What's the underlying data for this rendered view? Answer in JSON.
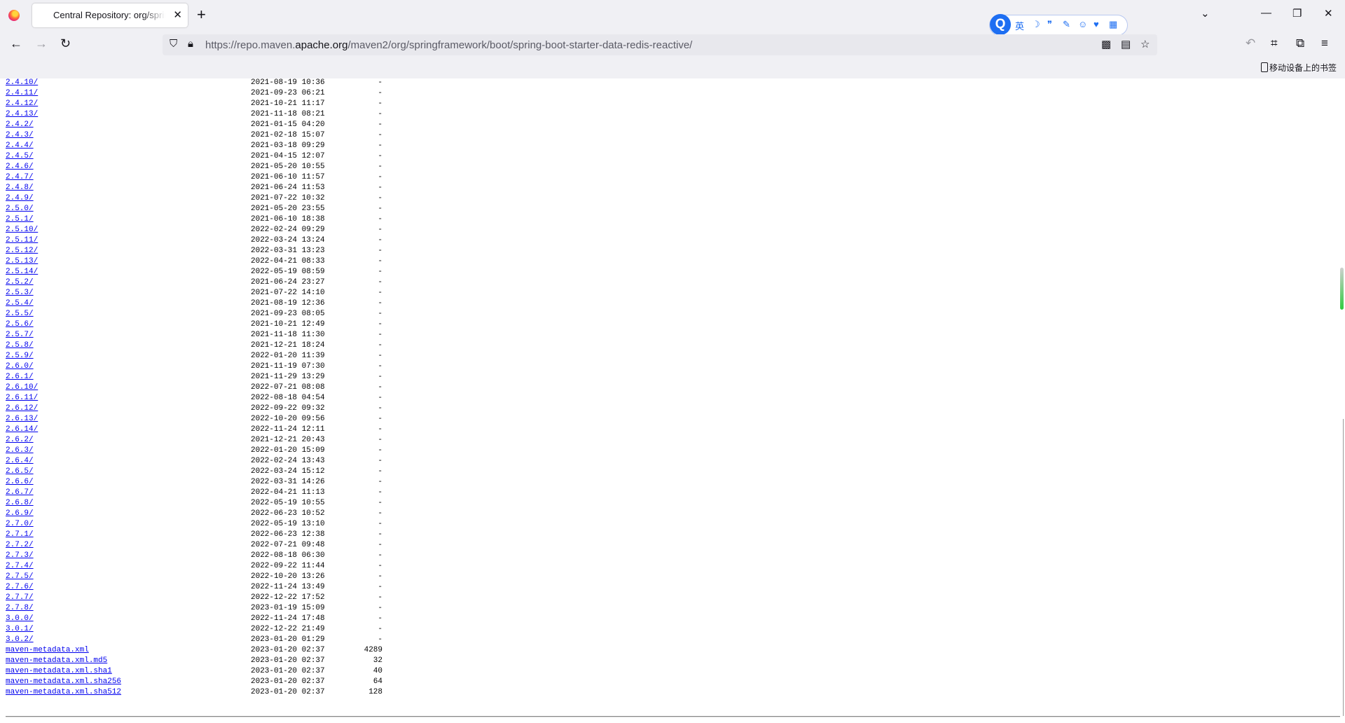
{
  "tab": {
    "title": "Central Repository: org/springframework/boot/spring-boot-starter-data-redis-reactive"
  },
  "url": {
    "host_prefix": "https://repo.maven.",
    "host_domain": "apache.org",
    "path": "/maven2/org/springframework/boot/spring-boot-starter-data-redis-reactive/"
  },
  "extension": {
    "label": "英"
  },
  "bookmarks": {
    "mobile": "移动设备上的书签"
  },
  "listing": [
    {
      "name": "2.4.10/",
      "date": "2021-08-19 10:36",
      "size": "-"
    },
    {
      "name": "2.4.11/",
      "date": "2021-09-23 06:21",
      "size": "-"
    },
    {
      "name": "2.4.12/",
      "date": "2021-10-21 11:17",
      "size": "-"
    },
    {
      "name": "2.4.13/",
      "date": "2021-11-18 08:21",
      "size": "-"
    },
    {
      "name": "2.4.2/",
      "date": "2021-01-15 04:20",
      "size": "-"
    },
    {
      "name": "2.4.3/",
      "date": "2021-02-18 15:07",
      "size": "-"
    },
    {
      "name": "2.4.4/",
      "date": "2021-03-18 09:29",
      "size": "-"
    },
    {
      "name": "2.4.5/",
      "date": "2021-04-15 12:07",
      "size": "-"
    },
    {
      "name": "2.4.6/",
      "date": "2021-05-20 10:55",
      "size": "-"
    },
    {
      "name": "2.4.7/",
      "date": "2021-06-10 11:57",
      "size": "-"
    },
    {
      "name": "2.4.8/",
      "date": "2021-06-24 11:53",
      "size": "-"
    },
    {
      "name": "2.4.9/",
      "date": "2021-07-22 10:32",
      "size": "-"
    },
    {
      "name": "2.5.0/",
      "date": "2021-05-20 23:55",
      "size": "-"
    },
    {
      "name": "2.5.1/",
      "date": "2021-06-10 18:38",
      "size": "-"
    },
    {
      "name": "2.5.10/",
      "date": "2022-02-24 09:29",
      "size": "-"
    },
    {
      "name": "2.5.11/",
      "date": "2022-03-24 13:24",
      "size": "-"
    },
    {
      "name": "2.5.12/",
      "date": "2022-03-31 13:23",
      "size": "-"
    },
    {
      "name": "2.5.13/",
      "date": "2022-04-21 08:33",
      "size": "-"
    },
    {
      "name": "2.5.14/",
      "date": "2022-05-19 08:59",
      "size": "-"
    },
    {
      "name": "2.5.2/",
      "date": "2021-06-24 23:27",
      "size": "-"
    },
    {
      "name": "2.5.3/",
      "date": "2021-07-22 14:10",
      "size": "-"
    },
    {
      "name": "2.5.4/",
      "date": "2021-08-19 12:36",
      "size": "-"
    },
    {
      "name": "2.5.5/",
      "date": "2021-09-23 08:05",
      "size": "-"
    },
    {
      "name": "2.5.6/",
      "date": "2021-10-21 12:49",
      "size": "-"
    },
    {
      "name": "2.5.7/",
      "date": "2021-11-18 11:30",
      "size": "-"
    },
    {
      "name": "2.5.8/",
      "date": "2021-12-21 18:24",
      "size": "-"
    },
    {
      "name": "2.5.9/",
      "date": "2022-01-20 11:39",
      "size": "-"
    },
    {
      "name": "2.6.0/",
      "date": "2021-11-19 07:30",
      "size": "-"
    },
    {
      "name": "2.6.1/",
      "date": "2021-11-29 13:29",
      "size": "-"
    },
    {
      "name": "2.6.10/",
      "date": "2022-07-21 08:08",
      "size": "-"
    },
    {
      "name": "2.6.11/",
      "date": "2022-08-18 04:54",
      "size": "-"
    },
    {
      "name": "2.6.12/",
      "date": "2022-09-22 09:32",
      "size": "-"
    },
    {
      "name": "2.6.13/",
      "date": "2022-10-20 09:56",
      "size": "-"
    },
    {
      "name": "2.6.14/",
      "date": "2022-11-24 12:11",
      "size": "-"
    },
    {
      "name": "2.6.2/",
      "date": "2021-12-21 20:43",
      "size": "-"
    },
    {
      "name": "2.6.3/",
      "date": "2022-01-20 15:09",
      "size": "-"
    },
    {
      "name": "2.6.4/",
      "date": "2022-02-24 13:43",
      "size": "-"
    },
    {
      "name": "2.6.5/",
      "date": "2022-03-24 15:12",
      "size": "-"
    },
    {
      "name": "2.6.6/",
      "date": "2022-03-31 14:26",
      "size": "-"
    },
    {
      "name": "2.6.7/",
      "date": "2022-04-21 11:13",
      "size": "-"
    },
    {
      "name": "2.6.8/",
      "date": "2022-05-19 10:55",
      "size": "-"
    },
    {
      "name": "2.6.9/",
      "date": "2022-06-23 10:52",
      "size": "-"
    },
    {
      "name": "2.7.0/",
      "date": "2022-05-19 13:10",
      "size": "-"
    },
    {
      "name": "2.7.1/",
      "date": "2022-06-23 12:38",
      "size": "-"
    },
    {
      "name": "2.7.2/",
      "date": "2022-07-21 09:48",
      "size": "-"
    },
    {
      "name": "2.7.3/",
      "date": "2022-08-18 06:30",
      "size": "-"
    },
    {
      "name": "2.7.4/",
      "date": "2022-09-22 11:44",
      "size": "-"
    },
    {
      "name": "2.7.5/",
      "date": "2022-10-20 13:26",
      "size": "-"
    },
    {
      "name": "2.7.6/",
      "date": "2022-11-24 13:49",
      "size": "-"
    },
    {
      "name": "2.7.7/",
      "date": "2022-12-22 17:52",
      "size": "-"
    },
    {
      "name": "2.7.8/",
      "date": "2023-01-19 15:09",
      "size": "-"
    },
    {
      "name": "3.0.0/",
      "date": "2022-11-24 17:48",
      "size": "-"
    },
    {
      "name": "3.0.1/",
      "date": "2022-12-22 21:49",
      "size": "-"
    },
    {
      "name": "3.0.2/",
      "date": "2023-01-20 01:29",
      "size": "-"
    },
    {
      "name": "maven-metadata.xml",
      "date": "2023-01-20 02:37",
      "size": "4289"
    },
    {
      "name": "maven-metadata.xml.md5",
      "date": "2023-01-20 02:37",
      "size": "32"
    },
    {
      "name": "maven-metadata.xml.sha1",
      "date": "2023-01-20 02:37",
      "size": "40"
    },
    {
      "name": "maven-metadata.xml.sha256",
      "date": "2023-01-20 02:37",
      "size": "64"
    },
    {
      "name": "maven-metadata.xml.sha512",
      "date": "2023-01-20 02:37",
      "size": "128"
    }
  ]
}
